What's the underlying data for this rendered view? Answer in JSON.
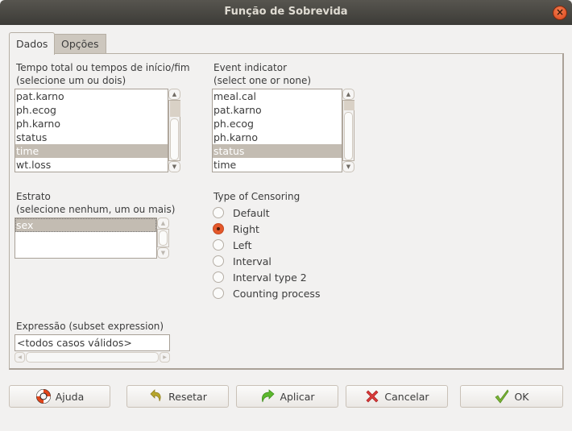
{
  "window": {
    "title": "Função de Sobrevida",
    "close_icon": "close-icon"
  },
  "tabs": [
    {
      "label": "Dados",
      "active": true
    },
    {
      "label": "Opções",
      "active": false
    }
  ],
  "time_list": {
    "label_line1": "Tempo total ou tempos de início/fim",
    "label_line2": "(selecione um ou dois)",
    "items": [
      "pat.karno",
      "ph.ecog",
      "ph.karno",
      "status",
      "time",
      "wt.loss"
    ],
    "selected": "time"
  },
  "event_list": {
    "label_line1": "Event indicator",
    "label_line2": "(select one or none)",
    "items": [
      "meal.cal",
      "pat.karno",
      "ph.ecog",
      "ph.karno",
      "status",
      "time"
    ],
    "selected": "status"
  },
  "strata_list": {
    "label_line1": "Estrato",
    "label_line2": "(selecione nenhum, um ou mais)",
    "items": [
      "sex"
    ],
    "selected": "sex"
  },
  "censoring": {
    "label": "Type of Censoring",
    "options": [
      "Default",
      "Right",
      "Left",
      "Interval",
      "Interval type 2",
      "Counting process"
    ],
    "selected": "Right"
  },
  "subset": {
    "label": "Expressão (subset expression)",
    "value": "<todos casos válidos>"
  },
  "buttons": {
    "help": {
      "label": "Ajuda",
      "icon": "lifebuoy-icon"
    },
    "reset": {
      "label": "Resetar",
      "icon": "undo-arrow-icon"
    },
    "apply": {
      "label": "Aplicar",
      "icon": "redo-arrow-icon"
    },
    "cancel": {
      "label": "Cancelar",
      "icon": "red-x-icon"
    },
    "ok": {
      "label": "OK",
      "icon": "checkmark-icon"
    }
  },
  "colors": {
    "accent_radio": "#e4582a",
    "selection": "#c3bcb2",
    "titlebar": "#3c3b37"
  }
}
